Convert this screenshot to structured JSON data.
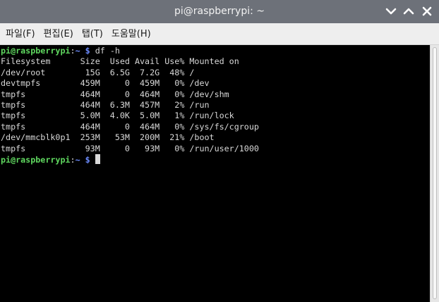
{
  "window": {
    "title": "pi@raspberrypi: ~",
    "controls": {
      "minimize": "chevron-down-icon",
      "maximize": "chevron-up-icon",
      "close": "close-icon"
    }
  },
  "menu": [
    {
      "label": "파일(F)"
    },
    {
      "label": "편집(E)"
    },
    {
      "label": "탭(T)"
    },
    {
      "label": "도움말(H)"
    }
  ],
  "terminal": {
    "colors": {
      "background": "#000000",
      "text": "#d8d8d8",
      "user": "#5fd75f",
      "path": "#6c8cff"
    },
    "prompt_user": "pi@raspberrypi",
    "prompt_colon": ":",
    "prompt_path": "~ $",
    "command": " df -h",
    "output": [
      "Filesystem      Size  Used Avail Use% Mounted on",
      "/dev/root        15G  6.5G  7.2G  48% /",
      "devtmpfs        459M     0  459M   0% /dev",
      "tmpfs           464M     0  464M   0% /dev/shm",
      "tmpfs           464M  6.3M  457M   2% /run",
      "tmpfs           5.0M  4.0K  5.0M   1% /run/lock",
      "tmpfs           464M     0  464M   0% /sys/fs/cgroup",
      "/dev/mmcblk0p1  253M   53M  200M  21% /boot",
      "tmpfs            93M     0   93M   0% /run/user/1000"
    ]
  }
}
